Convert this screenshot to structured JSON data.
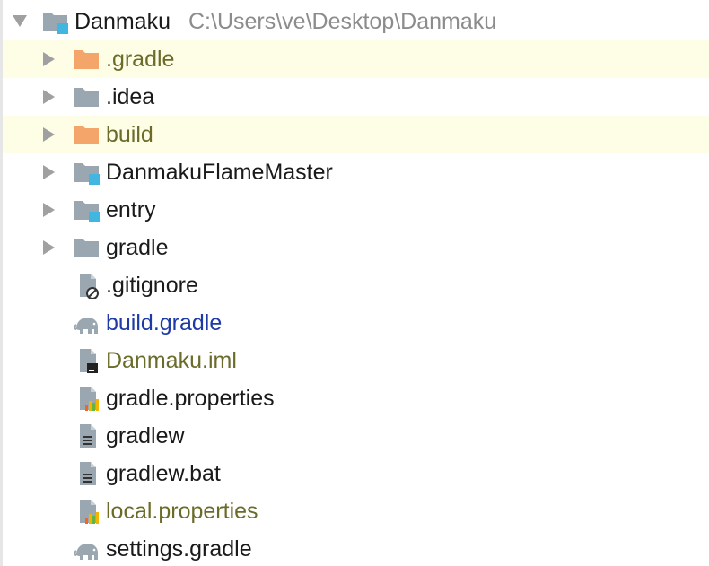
{
  "root": {
    "name": "Danmaku",
    "path": "C:\\Users\\ve\\Desktop\\Danmaku"
  },
  "items": [
    {
      "label": ".gradle",
      "icon": "folder-excluded-icon",
      "color": "#6b6b2a",
      "highlight": true,
      "expandable": true
    },
    {
      "label": ".idea",
      "icon": "folder-icon",
      "color": "#1a1a1a",
      "highlight": false,
      "expandable": true
    },
    {
      "label": "build",
      "icon": "folder-excluded-icon",
      "color": "#6b6b2a",
      "highlight": true,
      "expandable": true
    },
    {
      "label": "DanmakuFlameMaster",
      "icon": "module-folder-icon",
      "color": "#1a1a1a",
      "highlight": false,
      "expandable": true
    },
    {
      "label": "entry",
      "icon": "module-folder-icon",
      "color": "#1a1a1a",
      "highlight": false,
      "expandable": true
    },
    {
      "label": "gradle",
      "icon": "folder-icon",
      "color": "#1a1a1a",
      "highlight": false,
      "expandable": true
    },
    {
      "label": ".gitignore",
      "icon": "ignored-file-icon",
      "color": "#1a1a1a",
      "highlight": false,
      "expandable": false
    },
    {
      "label": "build.gradle",
      "icon": "gradle-elephant-icon",
      "color": "#1d3aa6",
      "highlight": false,
      "expandable": false
    },
    {
      "label": "Danmaku.iml",
      "icon": "iml-file-icon",
      "color": "#6b6b2a",
      "highlight": false,
      "expandable": false
    },
    {
      "label": "gradle.properties",
      "icon": "properties-file-icon",
      "color": "#1a1a1a",
      "highlight": false,
      "expandable": false
    },
    {
      "label": "gradlew",
      "icon": "text-file-icon",
      "color": "#1a1a1a",
      "highlight": false,
      "expandable": false
    },
    {
      "label": "gradlew.bat",
      "icon": "text-file-icon",
      "color": "#1a1a1a",
      "highlight": false,
      "expandable": false
    },
    {
      "label": "local.properties",
      "icon": "properties-file-icon",
      "color": "#6b6b2a",
      "highlight": false,
      "expandable": false
    },
    {
      "label": "settings.gradle",
      "icon": "gradle-elephant-icon",
      "color": "#1a1a1a",
      "highlight": false,
      "expandable": false
    }
  ],
  "colors": {
    "folder_gray": "#9aa7b0",
    "folder_orange": "#f4a66a",
    "module_badge": "#40b6e0",
    "highlight_bg": "#fefde6",
    "arrow": "#a0a0a0"
  }
}
